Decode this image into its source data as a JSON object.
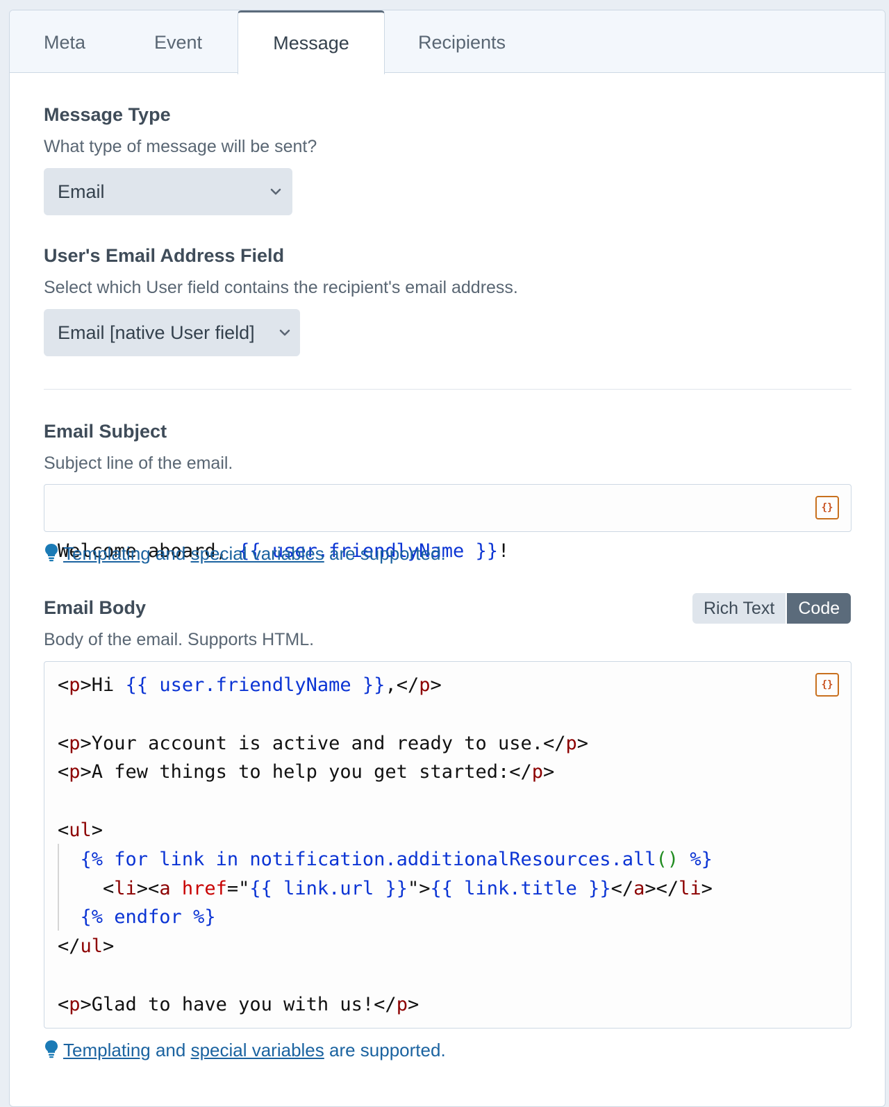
{
  "tabs": [
    "Meta",
    "Event",
    "Message",
    "Recipients"
  ],
  "message_type": {
    "label": "Message Type",
    "hint": "What type of message will be sent?",
    "selected": "Email"
  },
  "email_field": {
    "label": "User's Email Address Field",
    "hint": "Select which User field contains the recipient's email address.",
    "selected": "Email [native User field]"
  },
  "subject": {
    "label": "Email Subject",
    "hint": "Subject line of the email.",
    "value": "Welcome aboard, {{ user.friendlyName }}!"
  },
  "body": {
    "label": "Email Body",
    "hint": "Body of the email. Supports HTML.",
    "mode_options": [
      "Rich Text",
      "Code"
    ],
    "mode_selected": "Code",
    "code_lines": [
      "<p>Hi {{ user.friendlyName }},</p>",
      "",
      "<p>Your account is active and ready to use.</p>",
      "<p>A few things to help you get started:</p>",
      "",
      "<ul>",
      "  {% for link in notification.additionalResources.all() %}",
      "    <li><a href=\"{{ link.url }}\">{{ link.title }}</a></li>",
      "  {% endfor %}",
      "</ul>",
      "",
      "<p>Glad to have you with us!</p>"
    ]
  },
  "help_note": {
    "link1": "Templating",
    "mid": " and ",
    "link2": "special variables",
    "tail": " are supported."
  },
  "template_button": "{}",
  "icons": [
    "chevron-down-icon",
    "lightbulb-icon",
    "template-braces-icon"
  ],
  "colors": {
    "accent": "#5b6b7b",
    "link": "#1b63a0",
    "template_token": "#0b34d4",
    "html_tag": "#8c0000"
  }
}
